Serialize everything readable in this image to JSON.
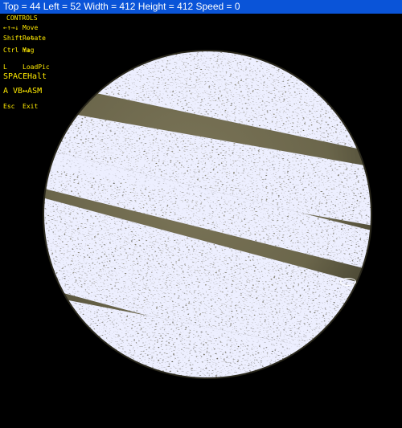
{
  "window": {
    "title": "Top = 44 Left = 52 Width = 412 Height = 412 Speed = 0"
  },
  "controls": {
    "header": "CONTROLS",
    "items": [
      {
        "key": "←↑→↓",
        "action": "Move"
      },
      {
        "key": "Shift ←→",
        "action": "Rotate"
      },
      {
        "key": "Ctrl ↑↓",
        "action": "Mag"
      },
      {
        "key": "L",
        "action": "LoadPic"
      },
      {
        "key": "SPACE",
        "action": "Halt"
      },
      {
        "key": "A",
        "action": "VB↔ASM"
      },
      {
        "key": "Esc",
        "action": "Exit"
      }
    ]
  },
  "colors": {
    "titlebar": "#0a54d8",
    "text": "#ffea00",
    "planet_base": "#6f6a4e",
    "planet_dark": "#1e1d14",
    "planet_light": "#cfd2ff"
  }
}
